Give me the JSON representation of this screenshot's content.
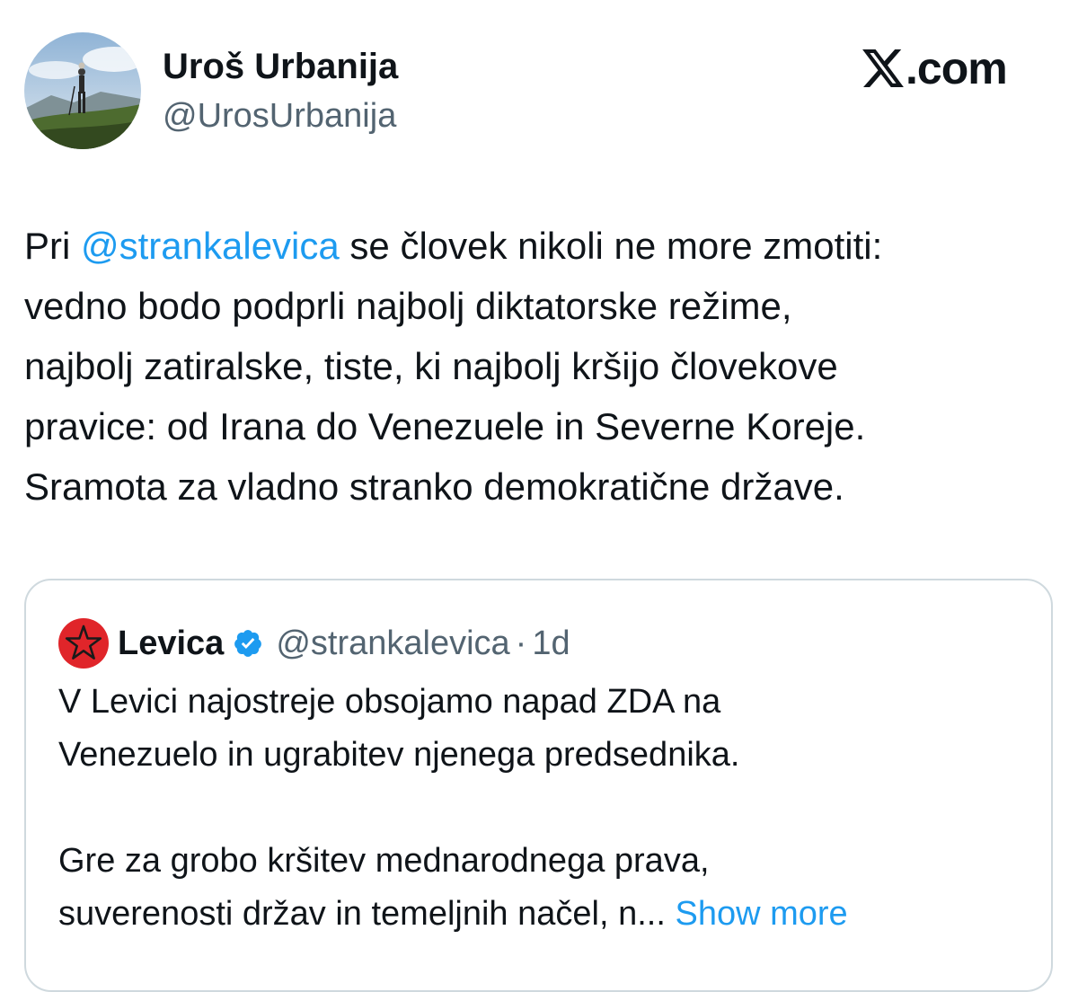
{
  "author": {
    "display_name": "Uroš Urbanija",
    "handle": "@UrosUrbanija",
    "avatar_icon": "profile-photo-mountain-hiker"
  },
  "brand": {
    "logo_icon": "x-logo-icon",
    "suffix": ".com"
  },
  "tweet": {
    "lines": [
      {
        "before": "Pri ",
        "mention": "@strankalevica",
        "after": " se človek nikoli ne more zmotiti:"
      },
      {
        "text": "vedno bodo podprli najbolj diktatorske režime,"
      },
      {
        "text": "najbolj zatiralske, tiste, ki najbolj kršijo človekove"
      },
      {
        "text": "pravice: od Irana do Venezuele in Severne Koreje."
      },
      {
        "text": "Sramota za vladno stranko demokratične države."
      }
    ]
  },
  "quoted_tweet": {
    "avatar_icon": "red-star-logo-icon",
    "name": "Levica",
    "verified_icon": "verified-badge-icon",
    "handle": "@strankalevica",
    "separator": "·",
    "time": "1d",
    "lines": [
      "V Levici najostreje obsojamo napad ZDA na",
      "Venezuelo in ugrabitev njenega predsednika.",
      "",
      "Gre za grobo kršitev mednarodnega prava,"
    ],
    "last_line": "suverenosti držav in temeljnih načel, n...",
    "show_more": "Show more"
  },
  "colors": {
    "text": "#0f1419",
    "secondary": "#536471",
    "link": "#1d9bf0",
    "border": "#cfd9de",
    "levica_red": "#e0252a"
  }
}
